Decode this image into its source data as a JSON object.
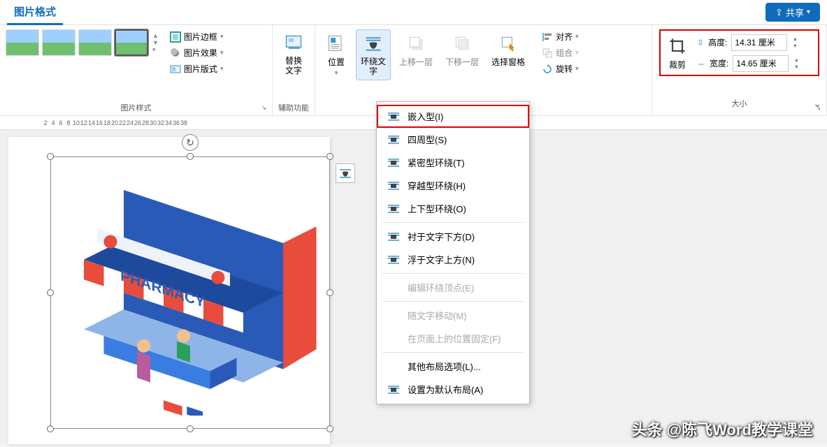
{
  "tab": {
    "active": "图片格式"
  },
  "share": {
    "label": "共享"
  },
  "groups": {
    "styles": {
      "label": "图片样式",
      "border": "图片边框",
      "effects": "图片效果",
      "layout": "图片版式"
    },
    "access": {
      "label": "辅助功能",
      "alt": "替换\n文字"
    },
    "arrange": {
      "position": "位置",
      "wrap": "环绕文\n字",
      "forward": "上移一层",
      "backward": "下移一层",
      "selpane": "选择窗格",
      "align": "对齐",
      "group": "组合",
      "rotate": "旋转"
    },
    "size": {
      "label": "大小",
      "crop": "裁剪",
      "height_label": "高度:",
      "height_value": "14.31 厘米",
      "width_label": "宽度:",
      "width_value": "14.65 厘米"
    }
  },
  "dropdown": {
    "items": [
      {
        "label": "嵌入型(I)",
        "mn": "I",
        "sel": true
      },
      {
        "label": "四周型(S)",
        "mn": "S"
      },
      {
        "label": "紧密型环绕(T)",
        "mn": "T"
      },
      {
        "label": "穿越型环绕(H)",
        "mn": "H"
      },
      {
        "label": "上下型环绕(O)",
        "mn": "O"
      }
    ],
    "items2": [
      {
        "label": "衬于文字下方(D)",
        "mn": "D"
      },
      {
        "label": "浮于文字上方(N)",
        "mn": "N"
      }
    ],
    "edit": "编辑环绕顶点(E)",
    "move": "随文字移动(M)",
    "fix": "在页面上的位置固定(F)",
    "more": "其他布局选项(L)...",
    "default": "设置为默认布局(A)"
  },
  "image": {
    "sign": "PHARMACY"
  },
  "watermark": "头条 @陈飞Word教学课堂",
  "ruler": [
    2,
    4,
    6,
    8,
    10,
    12,
    14,
    16,
    18,
    20,
    22,
    24,
    26,
    28,
    30,
    32,
    34,
    36,
    38
  ]
}
